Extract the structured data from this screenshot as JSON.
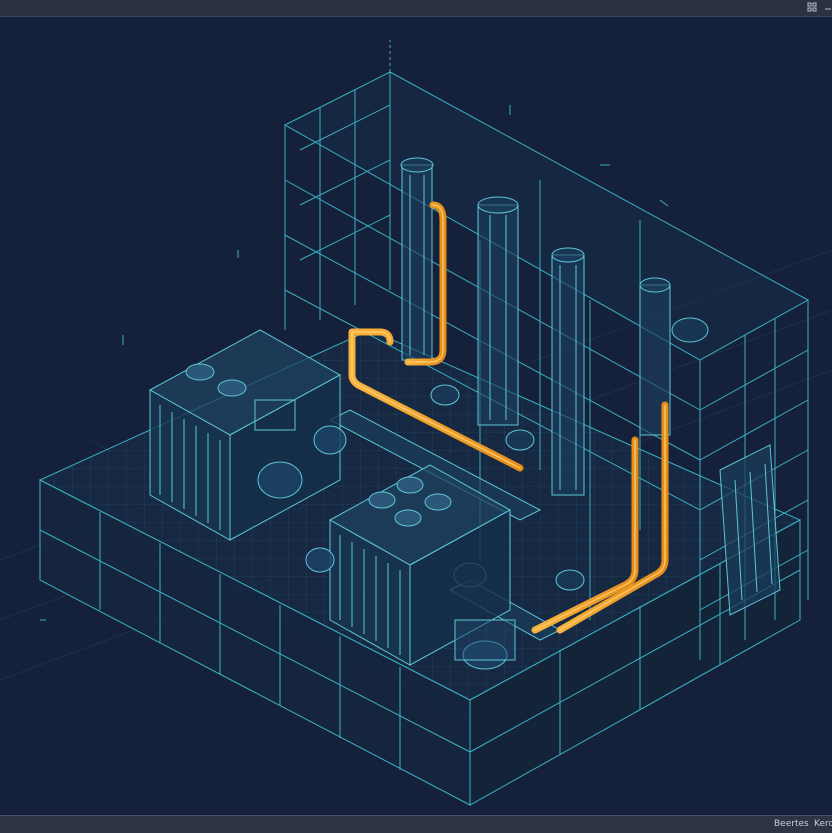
{
  "statusbar": {
    "tab_1": "Beertes",
    "tab_2": "Kerde"
  },
  "icons": {
    "grid": "grid-icon",
    "minimize": "minimize-icon"
  },
  "colors": {
    "background": "#16223a",
    "wireframe": "#3fb8c8",
    "pipe_highlight": "#f5a623"
  }
}
